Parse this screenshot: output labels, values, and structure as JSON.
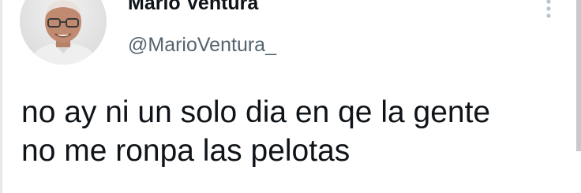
{
  "tweet": {
    "display_name": "Mario Ventura",
    "handle": "@MarioVentura_",
    "text_lines": [
      "no ay ni un solo dia en qe la gente",
      "no me ronpa las pelotas"
    ],
    "avatar_icon": "profile-photo",
    "more_icon": "vertical-ellipsis-icon"
  },
  "colors": {
    "text_primary": "#0f1419",
    "text_secondary": "#536471",
    "icon_muted": "#b8c3cc"
  }
}
